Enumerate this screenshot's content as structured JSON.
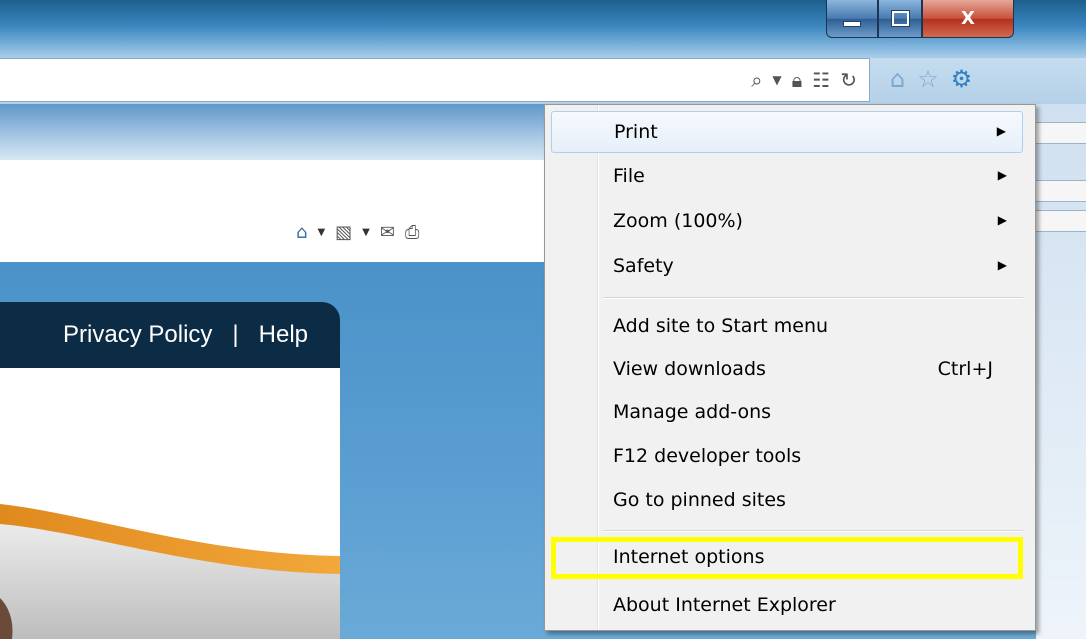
{
  "window": {
    "close_glyph": "X"
  },
  "address_bar": {
    "icons": [
      "search-icon",
      "dropdown-arrow-icon",
      "lock-icon",
      "compatibility-icon",
      "refresh-icon"
    ]
  },
  "nav": {
    "icons": [
      "home-icon",
      "favorites-star-icon",
      "tools-gear-icon"
    ],
    "gear_color": "#3b86c6"
  },
  "command_bar": {
    "icons": [
      "home-icon",
      "rss-feeds-icon",
      "read-mail-icon",
      "print-icon"
    ]
  },
  "page": {
    "links": [
      "Privacy Policy",
      "Help"
    ],
    "separator": "|"
  },
  "tools_menu": {
    "items": [
      {
        "label": "Print",
        "submenu": true,
        "state": "hover"
      },
      {
        "label": "File",
        "submenu": true
      },
      {
        "label": "Zoom (100%)",
        "submenu": true
      },
      {
        "label": "Safety",
        "submenu": true
      },
      {
        "label": "Add site to Start menu"
      },
      {
        "label": "View downloads",
        "shortcut": "Ctrl+J"
      },
      {
        "label": "Manage add-ons"
      },
      {
        "label": "F12 developer tools"
      },
      {
        "label": "Go to pinned sites"
      },
      {
        "label": "Internet options",
        "highlighted": true,
        "highlight_color": "#ffff00"
      },
      {
        "label": "About Internet Explorer"
      }
    ],
    "submenu_arrow": "▶"
  }
}
